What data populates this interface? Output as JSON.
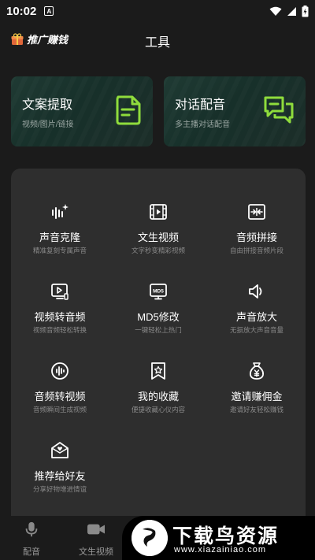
{
  "status_bar": {
    "time": "10:02",
    "app_badge": "A"
  },
  "header": {
    "promo_label": "推广赚钱",
    "title": "工具"
  },
  "cards": [
    {
      "title": "文案提取",
      "subtitle": "视频/图片/链接",
      "icon": "document-icon"
    },
    {
      "title": "对话配音",
      "subtitle": "多主播对话配音",
      "icon": "chat-icon"
    }
  ],
  "tools": [
    {
      "name": "声音克隆",
      "desc": "精准复刻专属声音",
      "icon": "voice-clone-icon"
    },
    {
      "name": "文生视频",
      "desc": "文字秒变精彩视频",
      "icon": "film-icon"
    },
    {
      "name": "音频拼接",
      "desc": "自由拼接音频片段",
      "icon": "merge-icon"
    },
    {
      "name": "视频转音频",
      "desc": "视频音频轻松转换",
      "icon": "video-convert-icon"
    },
    {
      "name": "MD5修改",
      "desc": "一键轻松上热门",
      "icon": "md5-icon"
    },
    {
      "name": "声音放大",
      "desc": "无损放大声音音量",
      "icon": "speaker-icon"
    },
    {
      "name": "音频转视频",
      "desc": "音频瞬间生成视频",
      "icon": "audio-to-video-icon"
    },
    {
      "name": "我的收藏",
      "desc": "便捷收藏心仪内容",
      "icon": "favorite-icon"
    },
    {
      "name": "邀请赚佣金",
      "desc": "邀请好友轻松赚钱",
      "icon": "money-bag-icon"
    },
    {
      "name": "推荐给好友",
      "desc": "分享好物增进情谊",
      "icon": "share-mail-icon"
    }
  ],
  "bottom_nav": [
    {
      "label": "配音",
      "icon": "microphone-icon"
    },
    {
      "label": "文生视频",
      "icon": "video-camera-icon"
    }
  ],
  "watermark": {
    "title": "下载鸟资源",
    "url": "www.xiazainiao.com"
  },
  "colors": {
    "background": "#1b1b1b",
    "panel": "#2e2e2e",
    "accent_green": "#8fdc3c",
    "card_bg": "#1d3630"
  }
}
